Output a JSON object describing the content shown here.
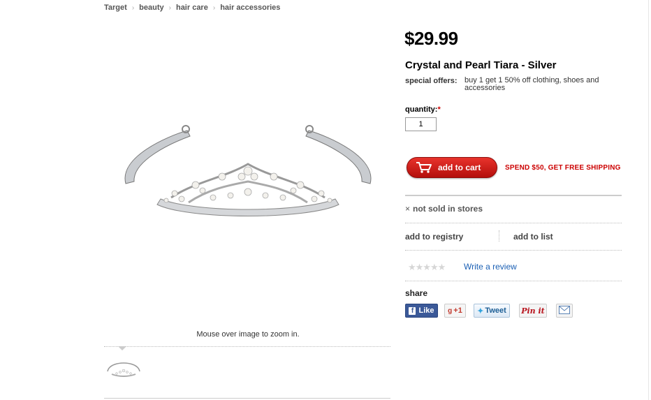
{
  "breadcrumb": [
    "Target",
    "beauty",
    "hair care",
    "hair accessories"
  ],
  "product": {
    "price": "$29.99",
    "title": "Crystal and Pearl Tiara - Silver",
    "special_offers_label": "special offers:",
    "special_offers_text": "buy 1 get 1 50% off clothing, shoes and accessories"
  },
  "quantity": {
    "label": "quantity:",
    "required_mark": "*",
    "value": "1"
  },
  "cart": {
    "add_label": "add to cart",
    "promo": "SPEND $50, GET FREE SHIPPING"
  },
  "availability": {
    "mark": "×",
    "text": "not sold in stores"
  },
  "actions": {
    "registry": "add to registry",
    "list": "add to list"
  },
  "reviews": {
    "stars": "★★★★★",
    "rating": 0,
    "write_label": "Write a review"
  },
  "share": {
    "label": "share",
    "facebook": "Like",
    "facebook_icon": "f",
    "google_icon": "g",
    "google": "+1",
    "twitter": "Tweet",
    "pinterest": "Pin it"
  },
  "image": {
    "zoom_hint": "Mouse over image to zoom in."
  },
  "colors": {
    "brand_red": "#cc0000",
    "link_blue": "#1a5fb4"
  }
}
